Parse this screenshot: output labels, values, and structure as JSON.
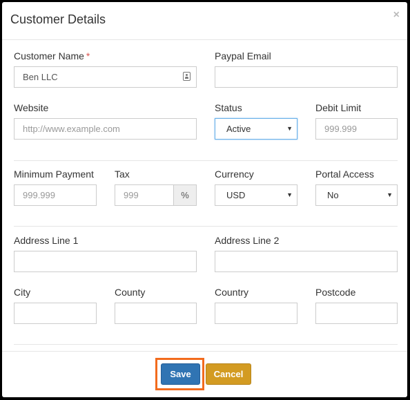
{
  "modal": {
    "title": "Customer Details",
    "close_glyph": "×"
  },
  "fields": {
    "customer_name": {
      "label": "Customer Name",
      "required_mark": "*",
      "value": "Ben LLC"
    },
    "paypal_email": {
      "label": "Paypal Email",
      "value": ""
    },
    "website": {
      "label": "Website",
      "placeholder": "http://www.example.com"
    },
    "status": {
      "label": "Status",
      "value": "Active"
    },
    "debit_limit": {
      "label": "Debit Limit",
      "placeholder": "999.999"
    },
    "minimum_payment": {
      "label": "Minimum Payment",
      "placeholder": "999.999"
    },
    "tax": {
      "label": "Tax",
      "placeholder": "999",
      "addon": "%"
    },
    "currency": {
      "label": "Currency",
      "value": "USD"
    },
    "portal_access": {
      "label": "Portal Access",
      "value": "No"
    },
    "address_line_1": {
      "label": "Address Line 1",
      "value": ""
    },
    "address_line_2": {
      "label": "Address Line 2",
      "value": ""
    },
    "city": {
      "label": "City",
      "value": ""
    },
    "county": {
      "label": "County",
      "value": ""
    },
    "country": {
      "label": "Country",
      "value": ""
    },
    "postcode": {
      "label": "Postcode",
      "value": ""
    }
  },
  "select_caret": "▼",
  "footer": {
    "save_label": "Save",
    "cancel_label": "Cancel"
  },
  "colors": {
    "save_button": "#3074b3",
    "cancel_button": "#d39b22",
    "highlight": "#f26b1d",
    "required": "#d9534f"
  },
  "icons": {
    "customer_name_addon": "contact-card-icon"
  }
}
